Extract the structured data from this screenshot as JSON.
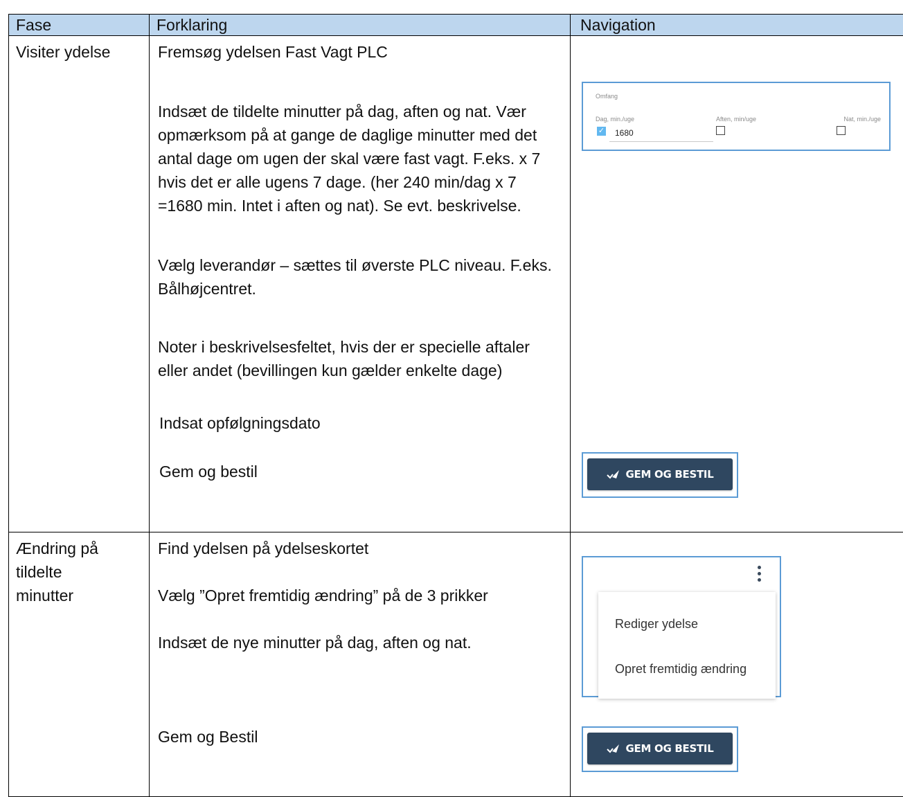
{
  "header": {
    "col1": "Fase",
    "col2": "Forklaring",
    "col3": "Navigation"
  },
  "rows": [
    {
      "phase": "Visiter ydelse",
      "paragraphs": [
        "Fremsøg ydelsen Fast Vagt PLC",
        "Indsæt de tildelte minutter på dag, aften og nat. Vær opmærksom på at gange de daglige minutter med det antal dage om ugen der skal være fast vagt. F.eks. x 7 hvis det er alle ugens 7 dage. (her 240 min/dag x 7 =1680 min. Intet i aften og nat). Se evt. beskrivelse.",
        "Vælg leverandør – sættes til øverste PLC niveau. F.eks. Bålhøjcentret.",
        "Noter i beskrivelsesfeltet, hvis der er specielle aftaler eller andet (bevillingen kun gælder enkelte dage)",
        "Indsat opfølgningsdato",
        "Gem og bestil"
      ],
      "nav": {
        "omfang_title": "Omfang",
        "dag_label": "Dag, min./uge",
        "dag_value": "1680",
        "dag_checked": true,
        "aften_label": "Aften, min/uge",
        "aften_checked": false,
        "nat_label": "Nat, min./uge",
        "nat_checked": false,
        "button_label": "GEM OG BESTIL",
        "button_color": "#2f4760"
      }
    },
    {
      "phase": "Ændring på tildelte minutter",
      "paragraphs": [
        "Find ydelsen på ydelseskortet",
        "Vælg ”Opret fremtidig ændring” på de 3 prikker",
        "Indsæt de nye minutter på dag, aften og nat.",
        "Gem og Bestil"
      ],
      "nav": {
        "menu_items": [
          "Rediger ydelse",
          "Opret fremtidig ændring"
        ],
        "button_label": "GEM OG BESTIL"
      }
    }
  ],
  "colors": {
    "header_bg": "#bdd6ee",
    "image_border": "#5b9bd5",
    "checkbox_checked": "#62b8f0"
  }
}
